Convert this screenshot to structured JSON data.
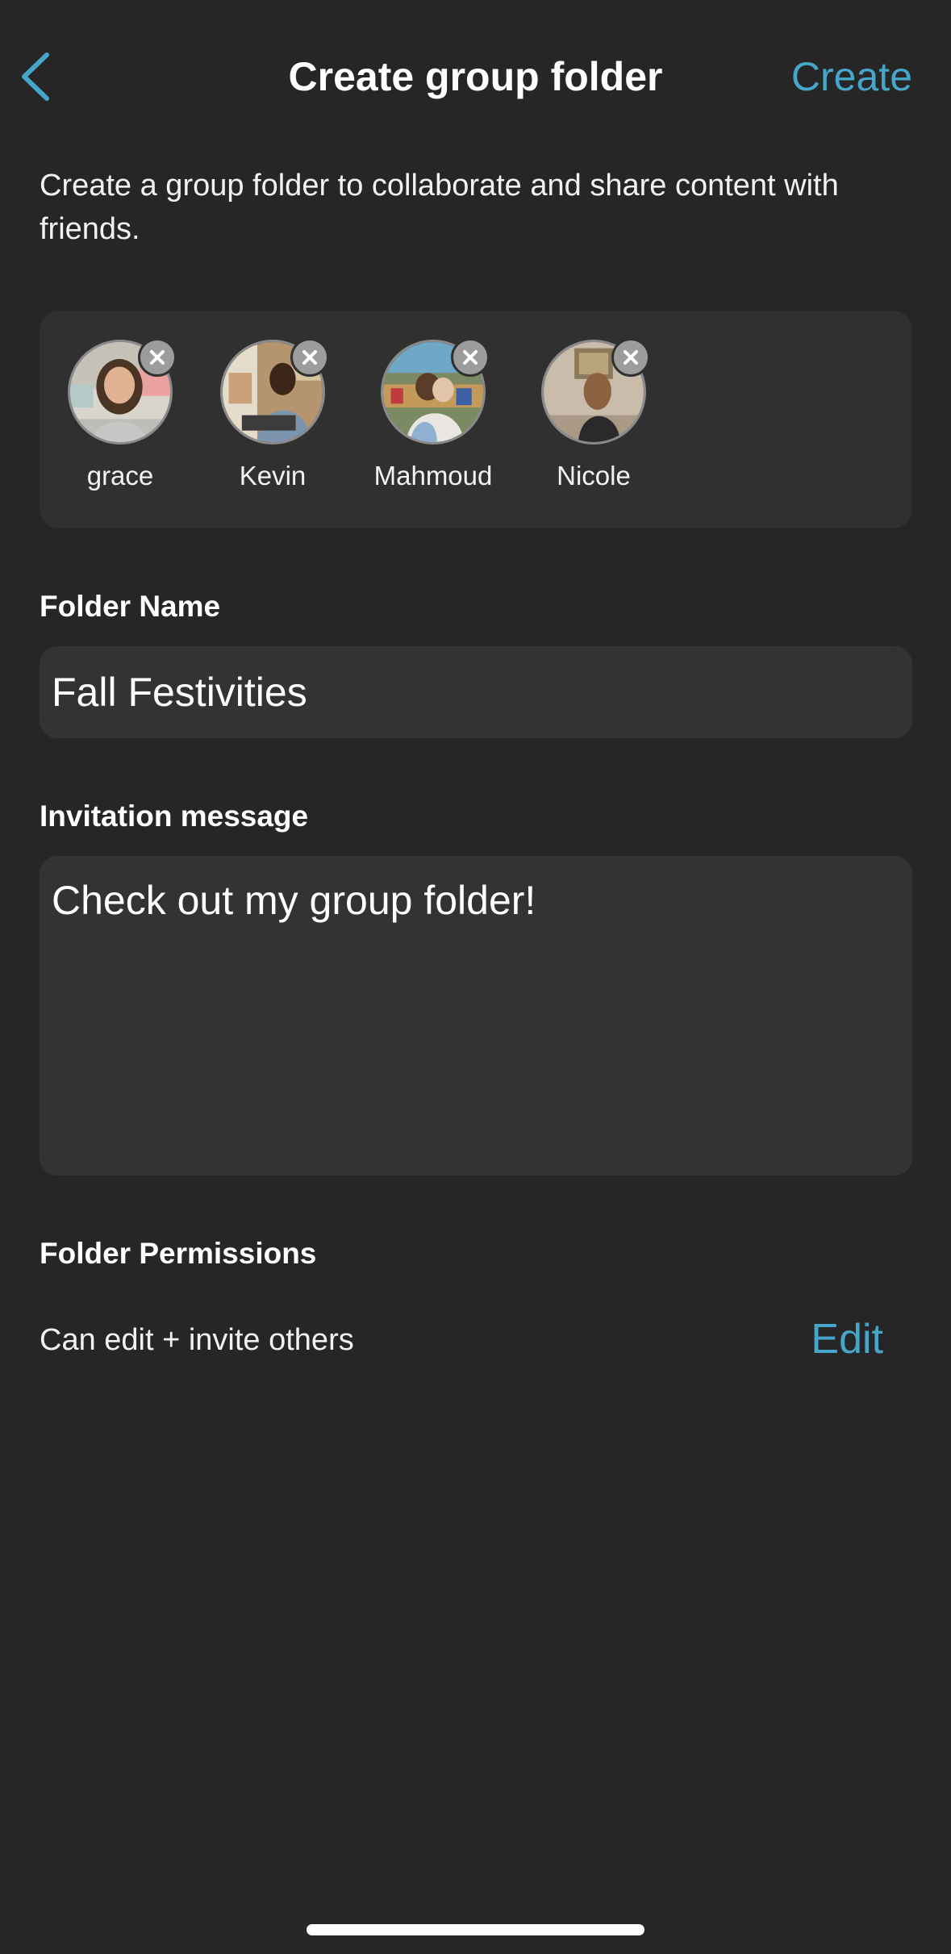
{
  "header": {
    "title": "Create group folder",
    "create_label": "Create",
    "back_icon": "chevron-left-icon"
  },
  "description": "Create a group folder to collaborate and share content with friends.",
  "recipients": [
    {
      "name": "grace"
    },
    {
      "name": "Kevin"
    },
    {
      "name": "Mahmoud"
    },
    {
      "name": "Nicole"
    }
  ],
  "folder_name": {
    "label": "Folder Name",
    "value": "Fall Festivities"
  },
  "invitation": {
    "label": "Invitation message",
    "value": "Check out my group folder!"
  },
  "permissions": {
    "label": "Folder Permissions",
    "value": "Can edit + invite others",
    "edit_label": "Edit"
  },
  "colors": {
    "background": "#262626",
    "card": "#303030",
    "accent": "#45a6c9"
  }
}
